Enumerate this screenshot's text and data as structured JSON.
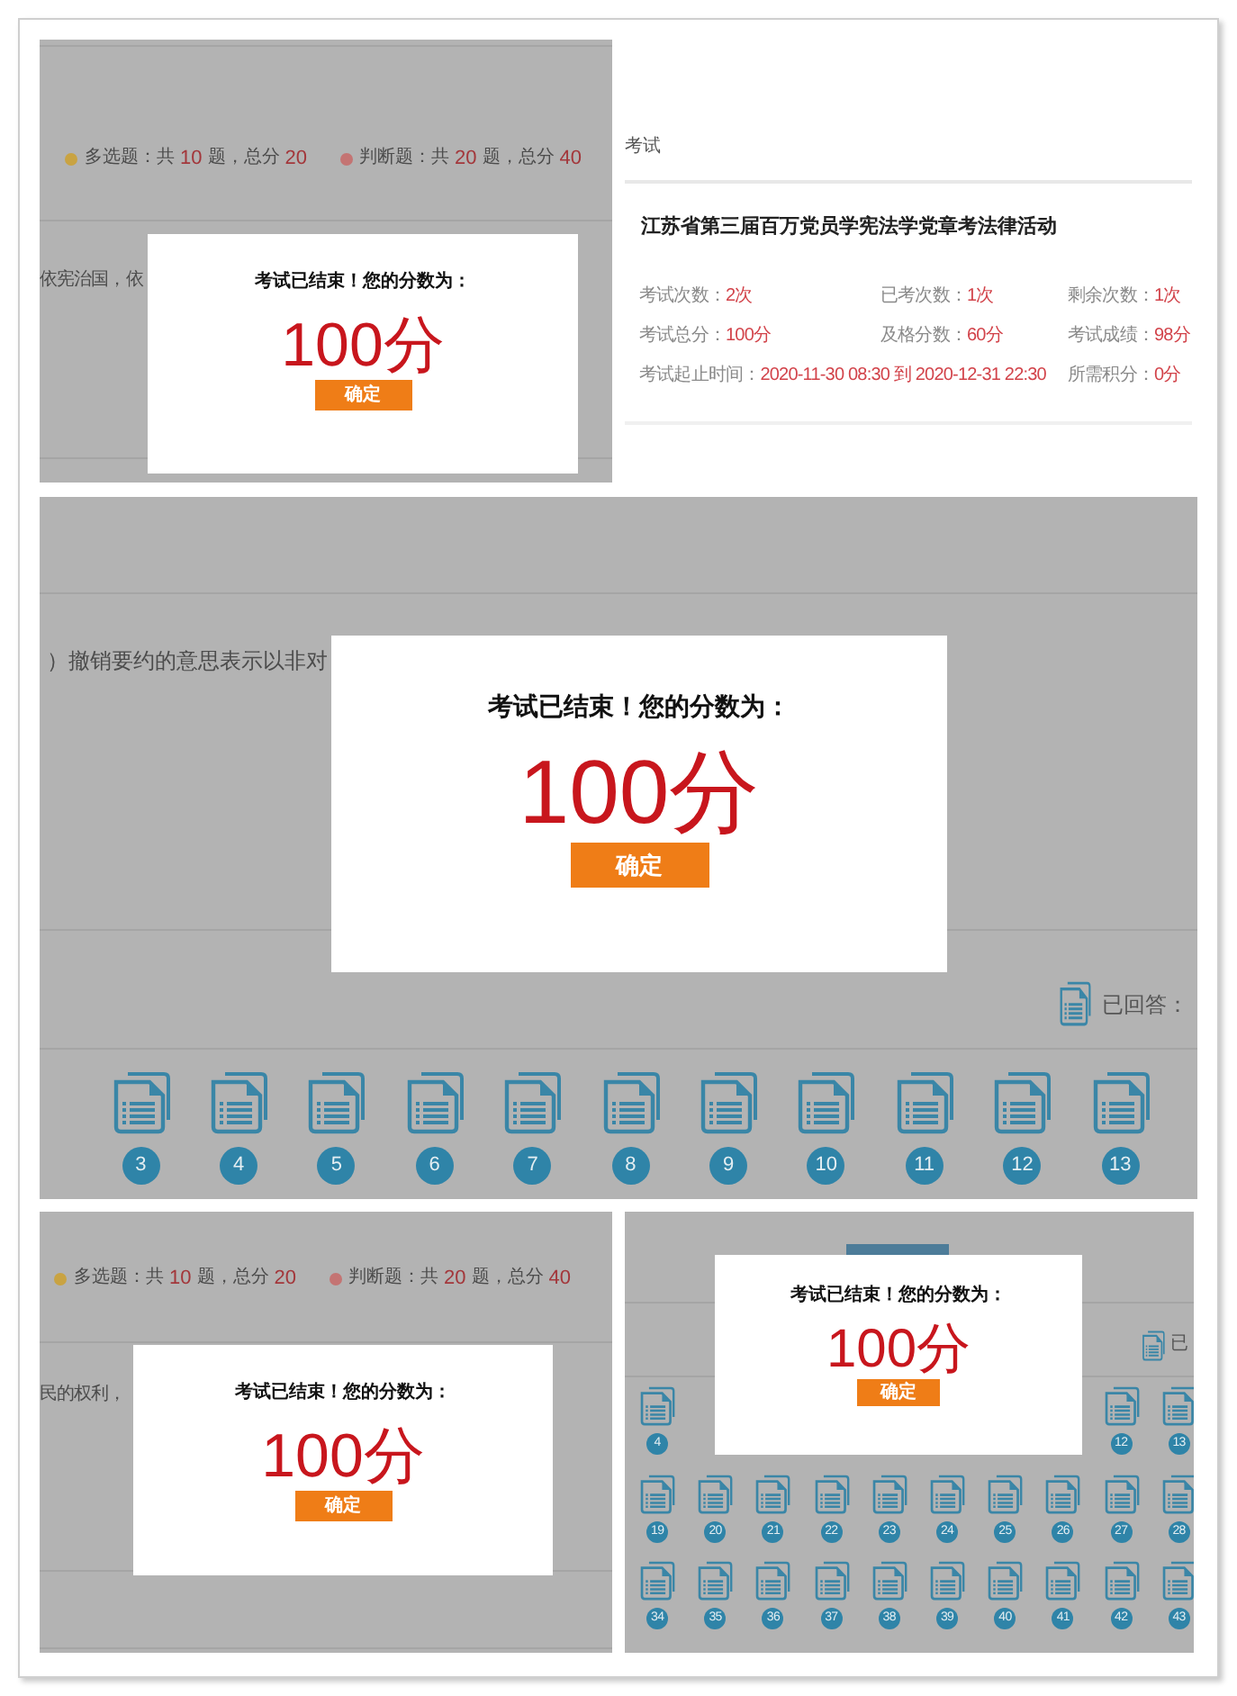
{
  "frames": [
    {
      "kind": "question_page",
      "legend": [
        {
          "type": "多选题：共",
          "count": "10",
          "unit": "题，总分",
          "score": "20",
          "color": "#c9a342"
        },
        {
          "type": "判断题：共",
          "count": "20",
          "unit": "题，总分",
          "score": "40",
          "color": "#c47473"
        }
      ],
      "question_excerpt": "依宪治国，依",
      "dialog": {
        "message": "考试已结束！您的分数为：",
        "score": "100分",
        "button": "确定"
      }
    },
    {
      "kind": "exam_info",
      "section": "考试",
      "exam_title": "江苏省第三届百万党员学宪法学党章考法律活动",
      "stat_rows": [
        [
          {
            "label": "考试次数：",
            "value": "2次"
          },
          {
            "label": "已考次数：",
            "value": "1次"
          },
          {
            "label": "剩余次数：",
            "value": "1次"
          }
        ],
        [
          {
            "label": "考试总分：",
            "value": "100分"
          },
          {
            "label": "及格分数：",
            "value": "60分"
          },
          {
            "label": "考试成绩：",
            "value": "98分"
          }
        ],
        [
          {
            "label": "考试起止时间：",
            "value": "2020-11-30 08:30 到 2020-12-31 22:30"
          },
          {
            "label": "所需积分：",
            "value": "0分"
          }
        ]
      ]
    },
    {
      "kind": "answer_strip",
      "question_excerpt": "）撤销要约的意思表示以非对",
      "answered_label": "已回答：",
      "questions": [
        "3",
        "4",
        "5",
        "6",
        "7",
        "8",
        "9",
        "10",
        "11",
        "12",
        "13"
      ],
      "dialog": {
        "message": "考试已结束！您的分数为：",
        "score": "100分",
        "button": "确定"
      }
    },
    {
      "kind": "question_page",
      "legend": [
        {
          "type": "多选题：共",
          "count": "10",
          "unit": "题，总分",
          "score": "20",
          "color": "#c9a342"
        },
        {
          "type": "判断题：共",
          "count": "20",
          "unit": "题，总分",
          "score": "40",
          "color": "#c47473"
        }
      ],
      "question_excerpt": "民的权利，",
      "dialog": {
        "message": "考试已结束！您的分数为：",
        "score": "100分",
        "button": "确定"
      }
    },
    {
      "kind": "answer_grid",
      "answered_label": "已",
      "question_rows": [
        {
          "start": [
            "4"
          ],
          "end": [
            "12",
            "13"
          ]
        },
        {
          "start": [
            "19",
            "20",
            "21",
            "22",
            "23",
            "24",
            "25",
            "26",
            "27",
            "28"
          ]
        },
        {
          "start": [
            "34",
            "35",
            "36",
            "37",
            "38",
            "39",
            "40",
            "41",
            "42",
            "43"
          ]
        }
      ],
      "dialog": {
        "message": "考试已结束！您的分数为：",
        "score": "100分",
        "button": "确定"
      }
    }
  ]
}
